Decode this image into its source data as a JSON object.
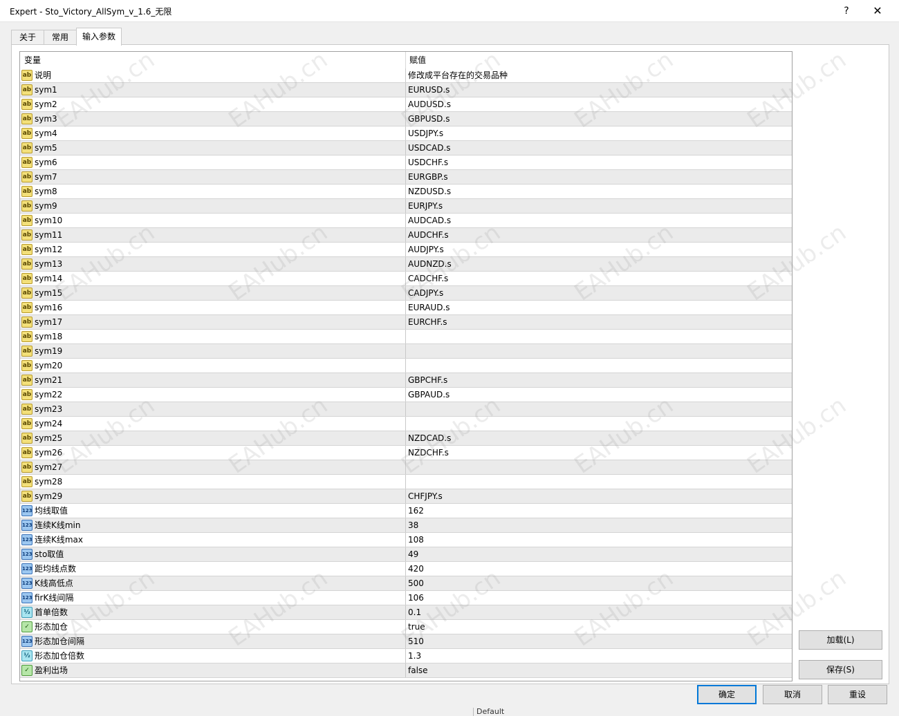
{
  "window": {
    "title": "Expert - Sto_Victory_AllSym_v_1.6_无限",
    "help": "?",
    "close": "✕"
  },
  "tabs": [
    {
      "label": "关于"
    },
    {
      "label": "常用"
    },
    {
      "label": "输入参数",
      "active": true
    }
  ],
  "table": {
    "col_name": "变量",
    "col_value": "赋值",
    "rows": [
      {
        "icon": "text-param-icon",
        "name": "说明",
        "value": "修改成平台存在的交易品种"
      },
      {
        "icon": "text-param-icon",
        "name": "sym1",
        "value": "EURUSD.s"
      },
      {
        "icon": "text-param-icon",
        "name": "sym2",
        "value": "AUDUSD.s"
      },
      {
        "icon": "text-param-icon",
        "name": "sym3",
        "value": "GBPUSD.s"
      },
      {
        "icon": "text-param-icon",
        "name": "sym4",
        "value": "USDJPY.s"
      },
      {
        "icon": "text-param-icon",
        "name": "sym5",
        "value": "USDCAD.s"
      },
      {
        "icon": "text-param-icon",
        "name": "sym6",
        "value": "USDCHF.s"
      },
      {
        "icon": "text-param-icon",
        "name": "sym7",
        "value": "EURGBP.s"
      },
      {
        "icon": "text-param-icon",
        "name": "sym8",
        "value": "NZDUSD.s"
      },
      {
        "icon": "text-param-icon",
        "name": "sym9",
        "value": "EURJPY.s"
      },
      {
        "icon": "text-param-icon",
        "name": "sym10",
        "value": "AUDCAD.s"
      },
      {
        "icon": "text-param-icon",
        "name": "sym11",
        "value": "AUDCHF.s"
      },
      {
        "icon": "text-param-icon",
        "name": "sym12",
        "value": "AUDJPY.s"
      },
      {
        "icon": "text-param-icon",
        "name": "sym13",
        "value": "AUDNZD.s"
      },
      {
        "icon": "text-param-icon",
        "name": "sym14",
        "value": "CADCHF.s"
      },
      {
        "icon": "text-param-icon",
        "name": "sym15",
        "value": "CADJPY.s"
      },
      {
        "icon": "text-param-icon",
        "name": "sym16",
        "value": "EURAUD.s"
      },
      {
        "icon": "text-param-icon",
        "name": "sym17",
        "value": "EURCHF.s"
      },
      {
        "icon": "text-param-icon",
        "name": "sym18",
        "value": ""
      },
      {
        "icon": "text-param-icon",
        "name": "sym19",
        "value": ""
      },
      {
        "icon": "text-param-icon",
        "name": "sym20",
        "value": ""
      },
      {
        "icon": "text-param-icon",
        "name": "sym21",
        "value": "GBPCHF.s"
      },
      {
        "icon": "text-param-icon",
        "name": "sym22",
        "value": "GBPAUD.s"
      },
      {
        "icon": "text-param-icon",
        "name": "sym23",
        "value": ""
      },
      {
        "icon": "text-param-icon",
        "name": "sym24",
        "value": ""
      },
      {
        "icon": "text-param-icon",
        "name": "sym25",
        "value": "NZDCAD.s"
      },
      {
        "icon": "text-param-icon",
        "name": "sym26",
        "value": "NZDCHF.s"
      },
      {
        "icon": "text-param-icon",
        "name": "sym27",
        "value": ""
      },
      {
        "icon": "text-param-icon",
        "name": "sym28",
        "value": ""
      },
      {
        "icon": "text-param-icon",
        "name": "sym29",
        "value": "CHFJPY.s"
      },
      {
        "icon": "integer-param-icon",
        "name": "均线取值",
        "value": "162"
      },
      {
        "icon": "integer-param-icon",
        "name": "连续K线min",
        "value": "38"
      },
      {
        "icon": "integer-param-icon",
        "name": "连续K线max",
        "value": "108"
      },
      {
        "icon": "integer-param-icon",
        "name": "sto取值",
        "value": "49"
      },
      {
        "icon": "integer-param-icon",
        "name": "距均线点数",
        "value": "420"
      },
      {
        "icon": "integer-param-icon",
        "name": "K线高低点",
        "value": "500"
      },
      {
        "icon": "integer-param-icon",
        "name": "firK线间隔",
        "value": "106"
      },
      {
        "icon": "double-param-icon",
        "name": "首单倍数",
        "value": "0.1"
      },
      {
        "icon": "bool-param-icon",
        "name": "形态加仓",
        "value": "true"
      },
      {
        "icon": "integer-param-icon",
        "name": "形态加仓间隔",
        "value": "510"
      },
      {
        "icon": "double-param-icon",
        "name": "形态加仓倍数",
        "value": "1.3"
      },
      {
        "icon": "bool-param-icon",
        "name": "盈利出场",
        "value": "false"
      }
    ]
  },
  "icons": {
    "text-param-icon": {
      "glyph": "ab",
      "bg": "#f3e07a",
      "border": "#b89a2a",
      "color": "#5a4800"
    },
    "integer-param-icon": {
      "glyph": "123",
      "bg": "#9cc7f0",
      "border": "#3a72b8",
      "color": "#0b3a78"
    },
    "double-param-icon": {
      "glyph": "½",
      "bg": "#a9e5f0",
      "border": "#3a9cb8",
      "color": "#0b5a78"
    },
    "bool-param-icon": {
      "glyph": "✓",
      "bg": "#b6e6a8",
      "border": "#4e9a3c",
      "color": "#1e5a10"
    }
  },
  "side_buttons": {
    "load": "加载(L)",
    "save": "保存(S)"
  },
  "footer_buttons": {
    "ok": "确定",
    "cancel": "取消",
    "reset": "重设"
  },
  "watermark": "EAHub.cn",
  "background_peek": "Default"
}
